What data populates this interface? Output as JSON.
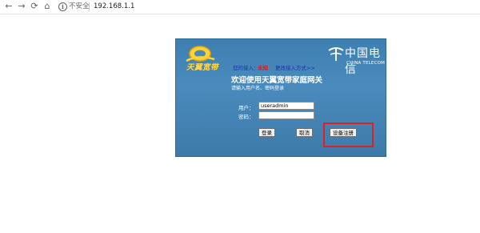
{
  "browser": {
    "back_icon": "←",
    "forward_icon": "→",
    "reload_icon": "⟳",
    "home_icon": "⌂",
    "info_icon": "i",
    "security_label": "不安全",
    "url": "192.168.1.1"
  },
  "login": {
    "logo_text": "天翼宽带",
    "brand_cn": "中国电信",
    "brand_en": "CHINA TELECOM",
    "access_label": "您的接入：",
    "access_value": "未知",
    "change_access_label": "更改接入方式>>",
    "welcome_title": "欢迎使用天翼宽带家庭网关",
    "hint_text": "请输入用户名、密码登录",
    "username_label": "用户：",
    "username_value": "useradmin",
    "password_label": "密码：",
    "password_value": "",
    "login_button": "登录",
    "cancel_button": "取消",
    "register_button": "设备注册"
  },
  "colors": {
    "panel_blue": "#4a8bbd",
    "highlight_red": "#e02020",
    "access_value_red": "#e01818",
    "link_blue": "#1d2fae"
  }
}
